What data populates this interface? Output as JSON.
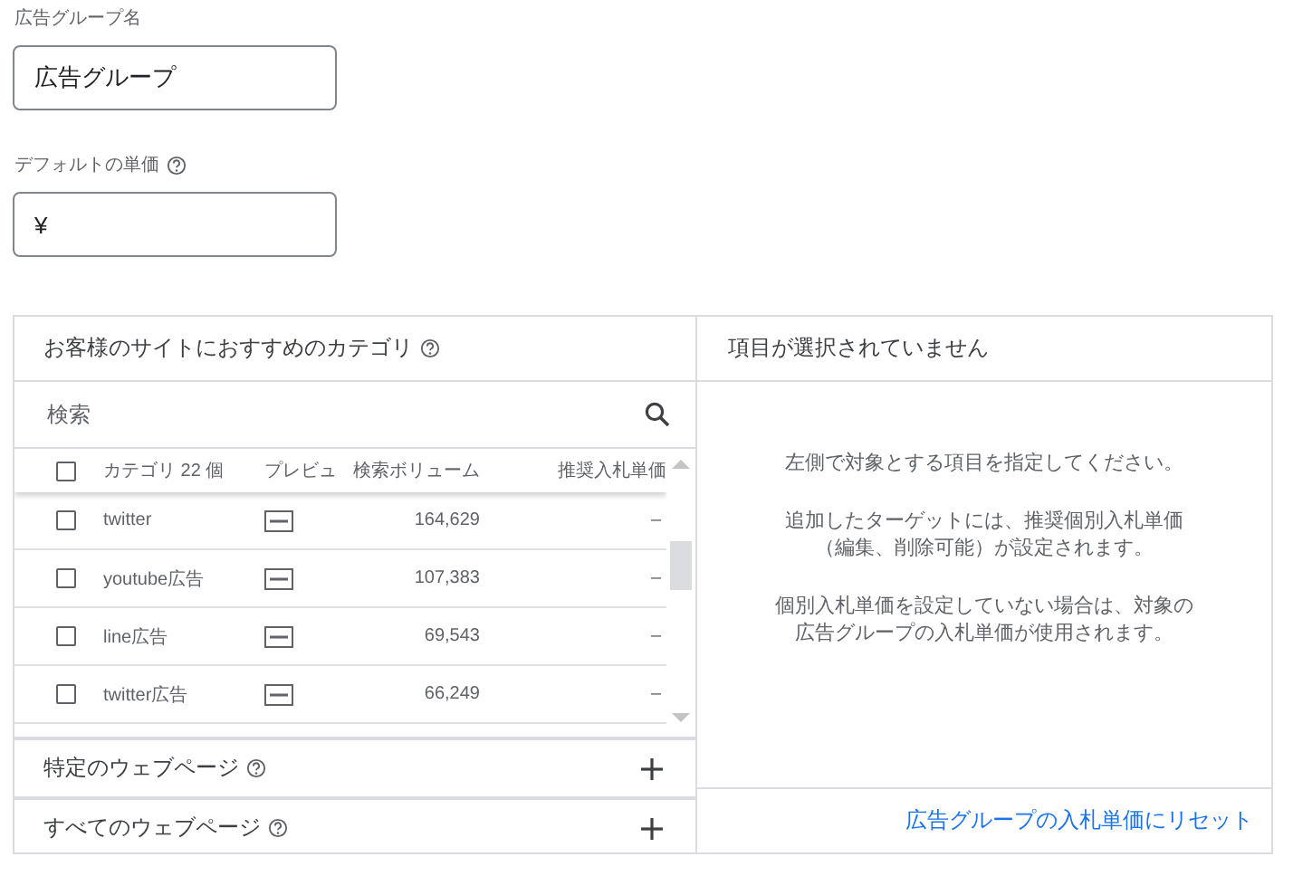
{
  "fields": [
    {
      "label": "広告グループ名",
      "value": "広告グループ",
      "help": false
    },
    {
      "label": "デフォルトの単価",
      "value": "¥",
      "help": true
    }
  ],
  "categories": {
    "title": "お客様のサイトにおすすめのカテゴリ",
    "search": {
      "placeholder": "検索"
    },
    "header": {
      "checked": false,
      "columns": [
        "カテゴリ 22 個",
        "プレビュ",
        "検索ボリューム",
        "推奨入札単価"
      ]
    },
    "rows": [
      {
        "name": "twitter",
        "volume": "164,629",
        "bid": "–",
        "checked": false
      },
      {
        "name": "youtube広告",
        "volume": "107,383",
        "bid": "–",
        "checked": false
      },
      {
        "name": "line広告",
        "volume": "69,543",
        "bid": "–",
        "checked": false
      },
      {
        "name": "twitter広告",
        "volume": "66,249",
        "bid": "–",
        "checked": false
      }
    ]
  },
  "sections": [
    {
      "title": "特定のウェブページ",
      "expanded": false
    },
    {
      "title": "すべてのウェブページ",
      "expanded": false
    }
  ],
  "detail": {
    "title": "項目が選択されていません",
    "paragraphs": [
      [
        "左側で対象とする項目を指定してください。"
      ],
      [
        "追加したターゲットには、推奨個別入札単価",
        "（編集、削除可能）が設定されます。"
      ],
      [
        "個別入札単価を設定していない場合は、対象の",
        "広告グループの入札単価が使用されます。"
      ]
    ],
    "link": "広告グループの入札単価にリセット"
  }
}
